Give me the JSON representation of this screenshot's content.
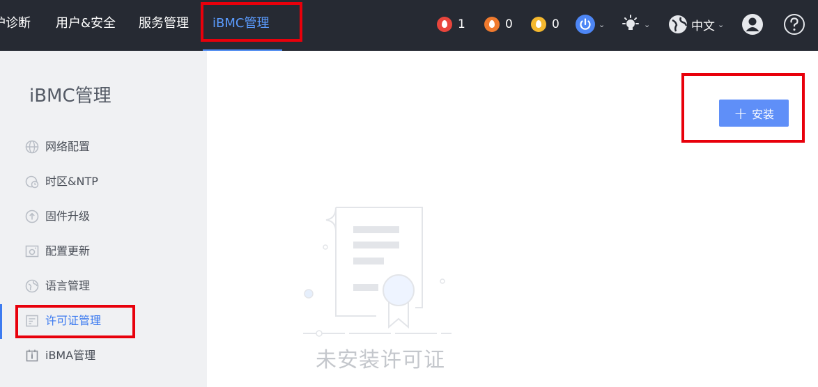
{
  "topnav": {
    "items": [
      {
        "label": "护诊断"
      },
      {
        "label": "用户&安全"
      },
      {
        "label": "服务管理"
      },
      {
        "label": "iBMC管理"
      }
    ]
  },
  "alerts": {
    "critical": {
      "count": "1",
      "color": "#e8453c"
    },
    "major": {
      "count": "0",
      "color": "#f07a2e"
    },
    "minor": {
      "count": "0",
      "color": "#f5b82e"
    }
  },
  "language": {
    "label": "中文"
  },
  "sidebar": {
    "title": "iBMC管理",
    "items": [
      {
        "label": "网络配置",
        "icon": "globe-icon"
      },
      {
        "label": "时区&NTP",
        "icon": "clock-icon"
      },
      {
        "label": "固件升级",
        "icon": "upgrade-icon"
      },
      {
        "label": "配置更新",
        "icon": "config-icon"
      },
      {
        "label": "语言管理",
        "icon": "language-icon"
      },
      {
        "label": "许可证管理",
        "icon": "license-icon"
      },
      {
        "label": "iBMA管理",
        "icon": "ibma-icon"
      }
    ]
  },
  "main": {
    "install_label": "安装",
    "empty_text": "未安装许可证"
  },
  "colors": {
    "topbar_bg": "#262a33",
    "accent": "#3d7bf0",
    "highlight_box": "#e8000b",
    "install_button": "#5f8ff8"
  }
}
